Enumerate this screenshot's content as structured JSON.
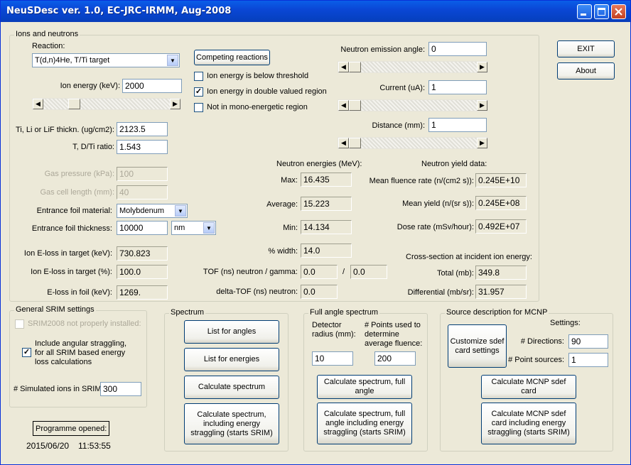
{
  "window": {
    "title": "NeuSDesc ver. 1.0, EC-JRC-IRMM, Aug-2008"
  },
  "ions": {
    "group_label": "Ions and neutrons",
    "reaction_label": "Reaction:",
    "reaction_value": "T(d,n)4He, T/Ti target",
    "competing_button": "Competing reactions",
    "checkboxes": [
      {
        "label": "Ion energy is below threshold",
        "checked": false
      },
      {
        "label": "Ion energy in double valued region",
        "checked": true
      },
      {
        "label": "Not in mono-energetic region",
        "checked": false
      }
    ],
    "ion_energy_label": "Ion energy (keV):",
    "ion_energy_value": "2000",
    "thickness_label": "Ti, Li or LiF thickn. (ug/cm2):",
    "thickness_value": "2123.5",
    "ratio_label": "T, D/Ti ratio:",
    "ratio_value": "1.543",
    "gas_pressure_label": "Gas pressure (kPa):",
    "gas_pressure_value": "100",
    "gas_cell_label": "Gas cell length (mm):",
    "gas_cell_value": "40",
    "foil_material_label": "Entrance foil material:",
    "foil_material_value": "Molybdenum",
    "foil_thickness_label": "Entrance foil thickness:",
    "foil_thickness_value": "10000",
    "foil_unit": "nm",
    "eloss_kev_label": "Ion E-loss in target (keV):",
    "eloss_kev_value": "730.823",
    "eloss_pct_label": "Ion E-loss in target (%):",
    "eloss_pct_value": "100.0",
    "eloss_foil_label": "E-loss in foil (keV):",
    "eloss_foil_value": "1269.",
    "emission_angle_label": "Neutron emission angle:",
    "emission_angle_value": "0",
    "current_label": "Current (uA):",
    "current_value": "1",
    "distance_label": "Distance (mm):",
    "distance_value": "1",
    "energies_heading": "Neutron energies (MeV):",
    "max_label": "Max:",
    "max_value": "16.435",
    "avg_label": "Average:",
    "avg_value": "15.223",
    "min_label": "Min:",
    "min_value": "14.134",
    "width_label": "% width:",
    "width_value": "14.0",
    "tof_label": "TOF (ns) neutron / gamma:",
    "tof_n_value": "0.0",
    "tof_sep": "/",
    "tof_g_value": "0.0",
    "dtof_label": "delta-TOF (ns) neutron:",
    "dtof_value": "0.0",
    "yield_heading": "Neutron yield data:",
    "fluence_label": "Mean fluence rate (n/(cm2 s)):",
    "fluence_value": "0.245E+10",
    "yield_label": "Mean yield (n/(sr s)):",
    "yield_value": "0.245E+08",
    "dose_label": "Dose rate (mSv/hour):",
    "dose_value": "0.492E+07",
    "xs_heading": "Cross-section at incident ion energy:",
    "total_label": "Total (mb):",
    "total_value": "349.8",
    "diff_label": "Differential (mb/sr):",
    "diff_value": "31.957"
  },
  "buttons": {
    "exit": "EXIT",
    "about": "About"
  },
  "srim": {
    "group_label": "General SRIM settings",
    "not_installed": "SRIM2008 not properly installed:",
    "straggling": "Include angular straggling, for all SRIM based energy loss calculations",
    "simulated_label": "# Simulated ions in SRIM:",
    "simulated_value": "300"
  },
  "status": {
    "opened_label": "Programme opened:",
    "date": "2015/06/20",
    "time": "11:53:55"
  },
  "spectrum": {
    "group_label": "Spectrum",
    "list_angles": "List for angles",
    "list_energies": "List for energies",
    "calc": "Calculate spectrum",
    "calc_srim": "Calculate spectrum, including energy straggling (starts SRIM)"
  },
  "full_angle": {
    "group_label": "Full angle spectrum",
    "detector_label": "Detector radius (mm):",
    "detector_value": "10",
    "points_label": "# Points used to determine average fluence:",
    "points_value": "200",
    "calc": "Calculate spectrum, full angle",
    "calc_srim": "Calculate spectrum, full angle including energy straggling (starts SRIM)"
  },
  "mcnp": {
    "group_label": "Source description for MCNP",
    "customize": "Customize sdef card settings",
    "settings_label": "Settings:",
    "directions_label": "# Directions:",
    "directions_value": "90",
    "points_label": "# Point sources:",
    "points_value": "1",
    "calc": "Calculate MCNP sdef card",
    "calc_srim": "Calculate MCNP sdef card including energy straggling (starts SRIM)"
  }
}
